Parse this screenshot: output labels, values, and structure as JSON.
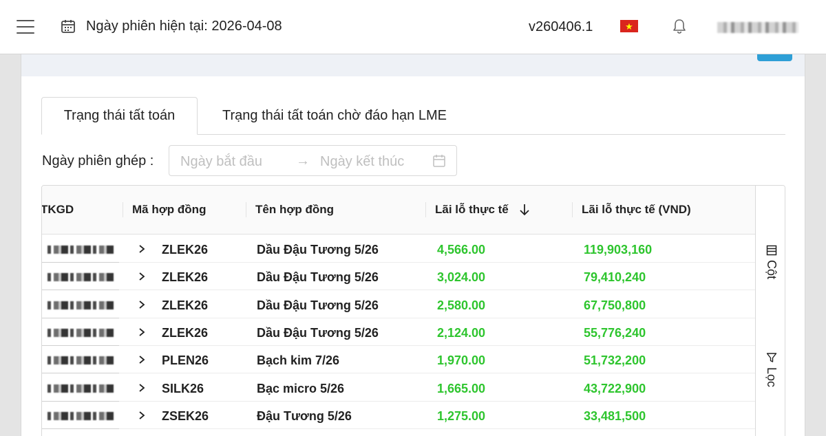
{
  "header": {
    "session_date": "Ngày phiên hiện tại: 2026-04-08",
    "version": "v260406.1",
    "flag_star": "★"
  },
  "tabs": [
    {
      "label": "Trạng thái tất toán",
      "active": true
    },
    {
      "label": "Trạng thái tất toán chờ đáo hạn LME",
      "active": false
    }
  ],
  "filter": {
    "label": "Ngày phiên ghép :",
    "start_placeholder": "Ngày bắt đầu",
    "arrow": "→",
    "end_placeholder": "Ngày kết thúc"
  },
  "table": {
    "columns": [
      "TKGD",
      "Mã hợp đồng",
      "Tên hợp đồng",
      "Lãi lỗ thực tế",
      "Lãi lỗ thực tế (VND)"
    ],
    "rows": [
      {
        "code": "ZLEK26",
        "name": "Dầu Đậu Tương 5/26",
        "pnl": "4,566.00",
        "pnl_vnd": "119,903,160"
      },
      {
        "code": "ZLEK26",
        "name": "Dầu Đậu Tương 5/26",
        "pnl": "3,024.00",
        "pnl_vnd": "79,410,240"
      },
      {
        "code": "ZLEK26",
        "name": "Dầu Đậu Tương 5/26",
        "pnl": "2,580.00",
        "pnl_vnd": "67,750,800"
      },
      {
        "code": "ZLEK26",
        "name": "Dầu Đậu Tương 5/26",
        "pnl": "2,124.00",
        "pnl_vnd": "55,776,240"
      },
      {
        "code": "PLEN26",
        "name": "Bạch kim 7/26",
        "pnl": "1,970.00",
        "pnl_vnd": "51,732,200"
      },
      {
        "code": "SILK26",
        "name": "Bạc micro 5/26",
        "pnl": "1,665.00",
        "pnl_vnd": "43,722,900"
      },
      {
        "code": "ZSEK26",
        "name": "Đậu Tương 5/26",
        "pnl": "1,275.00",
        "pnl_vnd": "33,481,500"
      }
    ]
  },
  "side": {
    "columns_label": "Cột",
    "filter_label": "Lọc"
  },
  "colors": {
    "profit_green": "#2ec52e",
    "accent_blue": "#2e9fd6",
    "flag_red": "#da251d"
  }
}
